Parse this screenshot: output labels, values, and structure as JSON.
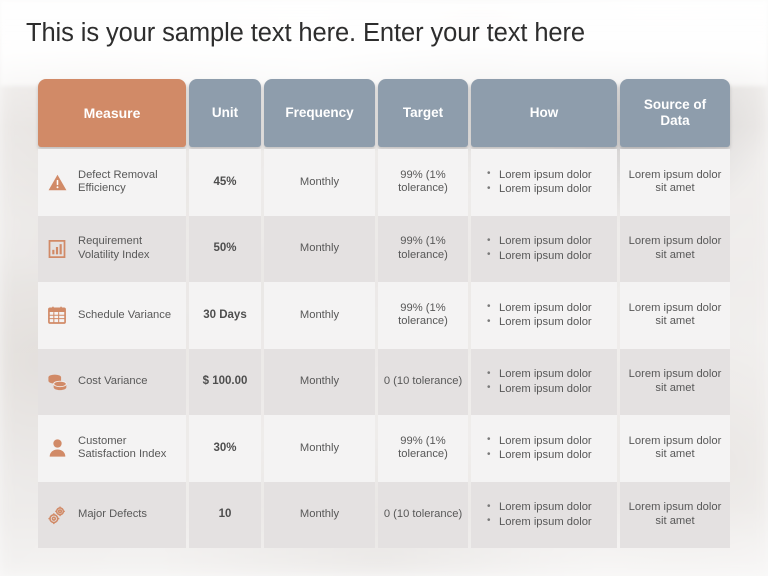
{
  "slide": {
    "title": "This is your sample text here. Enter your text here",
    "accent_orange": "#d18a67",
    "accent_gray": "#8e9dac"
  },
  "table": {
    "columns": [
      {
        "key": "measure",
        "label": "Measure"
      },
      {
        "key": "unit",
        "label": "Unit"
      },
      {
        "key": "frequency",
        "label": "Frequency"
      },
      {
        "key": "target",
        "label": "Target"
      },
      {
        "key": "how",
        "label": "How"
      },
      {
        "key": "source",
        "label": "Source of\nData"
      }
    ],
    "rows": [
      {
        "icon": "warning-triangle-icon",
        "measure": "Defect Removal Efficiency",
        "unit": "45%",
        "frequency": "Monthly",
        "target": "99% (1% tolerance)",
        "how": [
          "Lorem ipsum dolor",
          "Lorem ipsum dolor"
        ],
        "source": "Lorem ipsum dolor sit amet"
      },
      {
        "icon": "bar-chart-icon",
        "measure": "Requirement Volatility  Index",
        "unit": "50%",
        "frequency": "Monthly",
        "target": "99% (1% tolerance)",
        "how": [
          "Lorem ipsum dolor",
          "Lorem ipsum dolor"
        ],
        "source": "Lorem ipsum dolor sit amet"
      },
      {
        "icon": "calendar-icon",
        "measure": "Schedule Variance",
        "unit": "30 Days",
        "frequency": "Monthly",
        "target": "99% (1% tolerance)",
        "how": [
          "Lorem ipsum dolor",
          "Lorem ipsum dolor"
        ],
        "source": "Lorem ipsum dolor sit amet"
      },
      {
        "icon": "coins-stack-icon",
        "measure": "Cost Variance",
        "unit": "$ 100.00",
        "frequency": "Monthly",
        "target": "0 (10 tolerance)",
        "how": [
          "Lorem ipsum dolor",
          "Lorem ipsum dolor"
        ],
        "source": "Lorem ipsum dolor sit amet"
      },
      {
        "icon": "person-icon",
        "measure": "Customer Satisfaction Index",
        "unit": "30%",
        "frequency": "Monthly",
        "target": "99% (1% tolerance)",
        "how": [
          "Lorem ipsum dolor",
          "Lorem ipsum dolor"
        ],
        "source": "Lorem ipsum dolor sit amet"
      },
      {
        "icon": "gears-icon",
        "measure": "Major Defects",
        "unit": "10",
        "frequency": "Monthly",
        "target": "0 (10 tolerance)",
        "how": [
          "Lorem ipsum dolor",
          "Lorem ipsum dolor"
        ],
        "source": "Lorem ipsum dolor sit amet"
      }
    ]
  }
}
